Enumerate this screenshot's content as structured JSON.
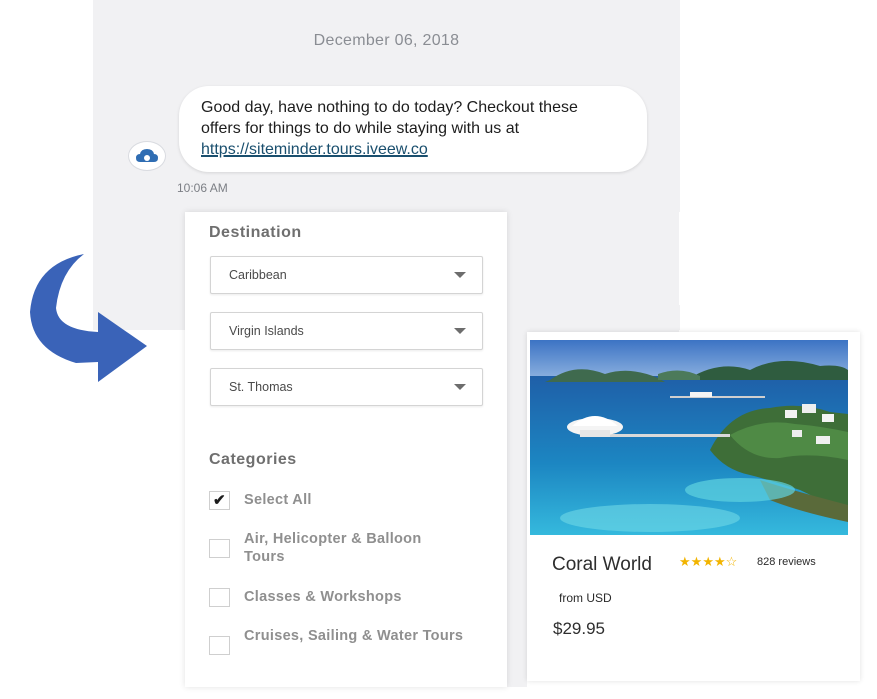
{
  "chat": {
    "date": "December 06, 2018",
    "message_line1": "Good day, have nothing to do today?  Checkout these",
    "message_line2": "offers for things to do while staying with us at",
    "link": "https://siteminder.tours.iveew.co",
    "time": "10:06 AM"
  },
  "filters": {
    "destination_title": "Destination",
    "selects": [
      {
        "value": "Caribbean"
      },
      {
        "value": "Virgin Islands"
      },
      {
        "value": "St. Thomas"
      }
    ],
    "categories_title": "Categories",
    "categories": [
      {
        "label": "Select All",
        "checked": true
      },
      {
        "label": "Air, Helicopter & Balloon Tours",
        "checked": false
      },
      {
        "label": "Classes & Workshops",
        "checked": false
      },
      {
        "label": "Cruises, Sailing & Water Tours",
        "checked": false
      }
    ]
  },
  "tour": {
    "name": "Coral World",
    "rating": 4,
    "rating_max": 5,
    "reviews": "828 reviews",
    "from_label": "from USD",
    "price": "$29.95"
  },
  "colors": {
    "arrow": "#3a63b8",
    "chat_bg": "#f1f1f3",
    "link": "#1a4f6e",
    "star": "#f2b400"
  }
}
